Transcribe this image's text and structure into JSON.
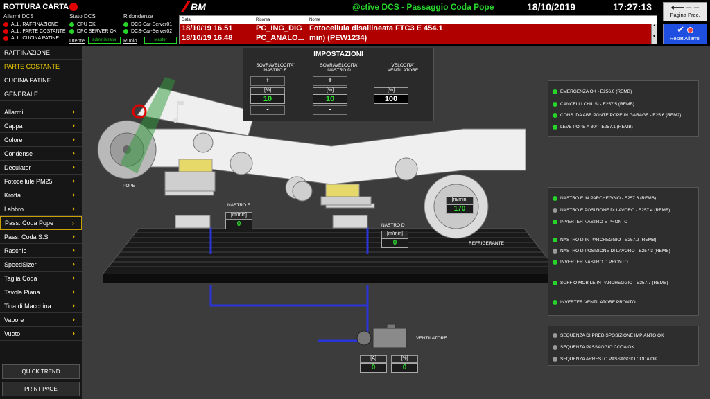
{
  "header": {
    "title": "ROTTURA CARTA",
    "app": "@ctive DCS - Passaggio Coda Pope",
    "date": "18/10/2019",
    "time": "17:27:13",
    "page_prec": "Pagina Prec.",
    "reset": "Reset Allarmi",
    "utente_label": "Utente",
    "utente_value": "administrator",
    "ruolo_label": "Ruolo",
    "ruolo_value": "Master"
  },
  "status": {
    "allarmi_title": "Allarmi DCS",
    "allarmi": [
      "ALL. RAFFINAZIONE",
      "ALL. PARTE COSTANTE",
      "ALL. CUCINA PATINE"
    ],
    "stato_title": "Stato DCS",
    "stato": [
      "CPU OK",
      "DPC SERVER OK"
    ],
    "rid_title": "Ridondanza",
    "rid": [
      "DCS-Car-Server01",
      "DCS-Car-Server02"
    ]
  },
  "alarms": {
    "headers": [
      "Data",
      "Risorsa",
      "Nome"
    ],
    "rows": [
      {
        "data": "18/10/19 16.51",
        "risorsa": "PC_ING_DIG",
        "nome": "Fotocellula disallineata FTC3 E 454.1"
      },
      {
        "data": "18/10/19 16.48",
        "risorsa": "PC_ANALO...",
        "nome": "min) (PEW1234)"
      }
    ]
  },
  "sidebar": {
    "top": [
      "RAFFINAZIONE",
      "PARTE COSTANTE",
      "CUCINA PATINE",
      "GENERALE"
    ],
    "items": [
      "Allarmi",
      "Cappa",
      "Colore",
      "Condense",
      "Deculator",
      "Fotocellule PM25",
      "Krofta",
      "Labbro",
      "Pass. Coda Pope",
      "Pass. Coda S.S",
      "Raschie",
      "SpeedSizer",
      "Taglia Coda",
      "Tavola Piana",
      "Tina di Macchina",
      "Vapore",
      "Vuoto"
    ],
    "quick_trend": "QUICK TREND",
    "print_page": "PRINT PAGE"
  },
  "impostazioni": {
    "title": "IMPOSTAZIONI",
    "cols": [
      {
        "label1": "SOVRAVELOCITA'",
        "label2": "NASTRO E",
        "unit": "[%]",
        "value": "10",
        "plus": "+",
        "minus": "-"
      },
      {
        "label1": "SOVRAVELOCITA'",
        "label2": "NASTRO D",
        "unit": "[%]",
        "value": "10",
        "plus": "+",
        "minus": "-"
      },
      {
        "label1": "VELOCITA'",
        "label2": "VENTILATORE",
        "unit": "[%]",
        "value": "100"
      }
    ]
  },
  "process": {
    "pope": "POPE",
    "nastro_e": "NASTRO E",
    "nastro_e_unit": "[m/min]",
    "nastro_e_val": "0",
    "nastro_d": "NASTRO D",
    "nastro_d_unit": "[m/min]",
    "nastro_d_val": "0",
    "refrigerante": "REFRIGERANTE",
    "roll_unit": "[m/min]",
    "roll_val": "170",
    "ventilatore": "VENTILATORE",
    "a_unit": "[A]",
    "a_val": "0",
    "p_unit": "[%]",
    "p_val": "0"
  },
  "panel1": [
    {
      "text": "EMERGENZA OK - E256.0 (REMB)",
      "color": "#27d42a"
    },
    {
      "text": "CANCELLI CHIUSI - E257.5 (REMB)",
      "color": "#27d42a"
    },
    {
      "text": "CONS. DA ABB PONTE POPE IN GARAGE - E25.6 (REM2)",
      "color": "#27d42a"
    },
    {
      "text": "LEVE POPE A 30° - E257.1 (REMB)",
      "color": "#27d42a"
    }
  ],
  "panel2": [
    {
      "text": "NASTRO E IN PARCHEGGIO - E257.6 (REMB)",
      "color": "#27d42a"
    },
    {
      "text": "NASTRO E POSIZIONE DI LAVORO - E257.4 (REMB)",
      "color": "#9a9a9a"
    },
    {
      "text": "INVERTER NASTRO E PRONTO",
      "color": "#27d42a"
    },
    {
      "text": "NASTRO D IN PARCHEGGIO - E257.2 (REMB)",
      "color": "#27d42a"
    },
    {
      "text": "NASTRO D POSIZIONE DI LAVORO - E257.3 (REMB)",
      "color": "#9a9a9a"
    },
    {
      "text": "INVERTER NASTRO D PRONTO",
      "color": "#27d42a"
    },
    {
      "text": "SOFFIO MOBILE IN PARCHEGGIO - E257.7 (REMB)",
      "color": "#27d42a"
    },
    {
      "text": "INVERTER VENTILATORE PRONTO",
      "color": "#27d42a"
    }
  ],
  "panel3": [
    {
      "text": "SEQUENZA DI PREDISPOSIZIONE IMPIANTO OK",
      "color": "#9a9a9a"
    },
    {
      "text": "SEQUENZA PASSAGGIO CODA OK",
      "color": "#9a9a9a"
    },
    {
      "text": "SEQUENZA ARRESTO PASSAGGIO CODA OK",
      "color": "#9a9a9a"
    }
  ]
}
